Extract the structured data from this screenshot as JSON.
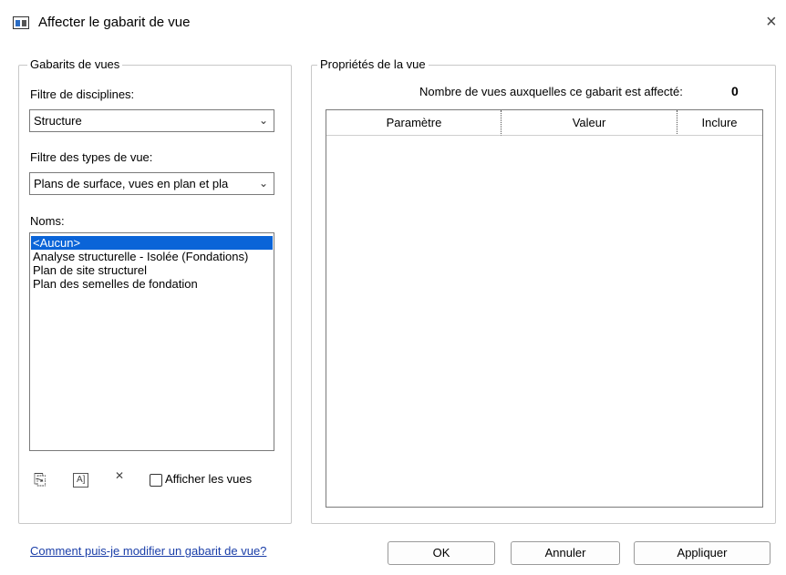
{
  "window": {
    "title": "Affecter le gabarit de vue",
    "close_glyph": "×"
  },
  "left_group": {
    "legend": "Gabarits de vues",
    "discipline_filter_label": "Filtre de disciplines:",
    "discipline_filter_value": "Structure",
    "view_type_filter_label": "Filtre des types de vue:",
    "view_type_filter_value": "Plans de surface, vues en plan et pla",
    "names_label": "Noms:",
    "names": [
      {
        "label": "<Aucun>",
        "selected": true
      },
      {
        "label": "Analyse structurelle - Isolée (Fondations)",
        "selected": false
      },
      {
        "label": "Plan de site structurel",
        "selected": false
      },
      {
        "label": "Plan des semelles de fondation",
        "selected": false
      }
    ],
    "tool_icons": [
      "duplicate-icon",
      "rename-icon",
      "delete-icon"
    ],
    "tool_glyphs": [
      "⎘",
      "A]",
      "✕"
    ],
    "show_views_label": "Afficher les vues"
  },
  "right_group": {
    "legend": "Propriétés de la vue",
    "assigned_count_label": "Nombre de vues auxquelles ce gabarit est affecté:",
    "assigned_count": "0",
    "columns": [
      "Paramètre",
      "Valeur",
      "Inclure"
    ]
  },
  "footer": {
    "help_link": "Comment puis-je modifier un gabarit de vue?",
    "ok_label": "OK",
    "cancel_label": "Annuler",
    "apply_label": "Appliquer"
  },
  "colors": {
    "selection": "#0a64d8",
    "link": "#1a3ea8"
  }
}
